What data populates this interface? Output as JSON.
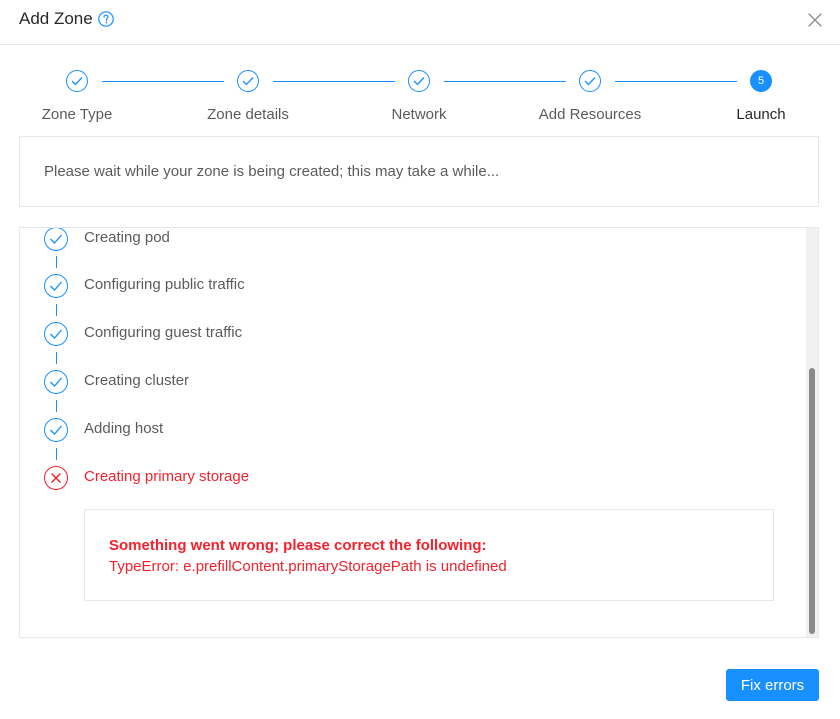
{
  "dialog": {
    "title": "Add Zone",
    "help_icon": "question-circle-icon",
    "close_icon": "close-icon"
  },
  "steps": {
    "items": [
      {
        "label": "Zone Type",
        "status": "done"
      },
      {
        "label": "Zone details",
        "status": "done"
      },
      {
        "label": "Network",
        "status": "done"
      },
      {
        "label": "Add Resources",
        "status": "done"
      },
      {
        "label": "Launch",
        "status": "active",
        "number": "5"
      }
    ]
  },
  "info": {
    "message": "Please wait while your zone is being created; this may take a while..."
  },
  "progress": {
    "items": [
      {
        "label": "Creating pod",
        "status": "done"
      },
      {
        "label": "Configuring public traffic",
        "status": "done"
      },
      {
        "label": "Configuring guest traffic",
        "status": "done"
      },
      {
        "label": "Creating cluster",
        "status": "done"
      },
      {
        "label": "Adding host",
        "status": "done"
      },
      {
        "label": "Creating primary storage",
        "status": "error"
      }
    ],
    "error": {
      "title": "Something went wrong; please correct the following:",
      "detail": "TypeError: e.prefillContent.primaryStoragePath is undefined"
    }
  },
  "footer": {
    "fix_button_label": "Fix errors"
  },
  "colors": {
    "accent": "#1890ff",
    "error": "#f5222d",
    "border": "#e8e8e8"
  }
}
